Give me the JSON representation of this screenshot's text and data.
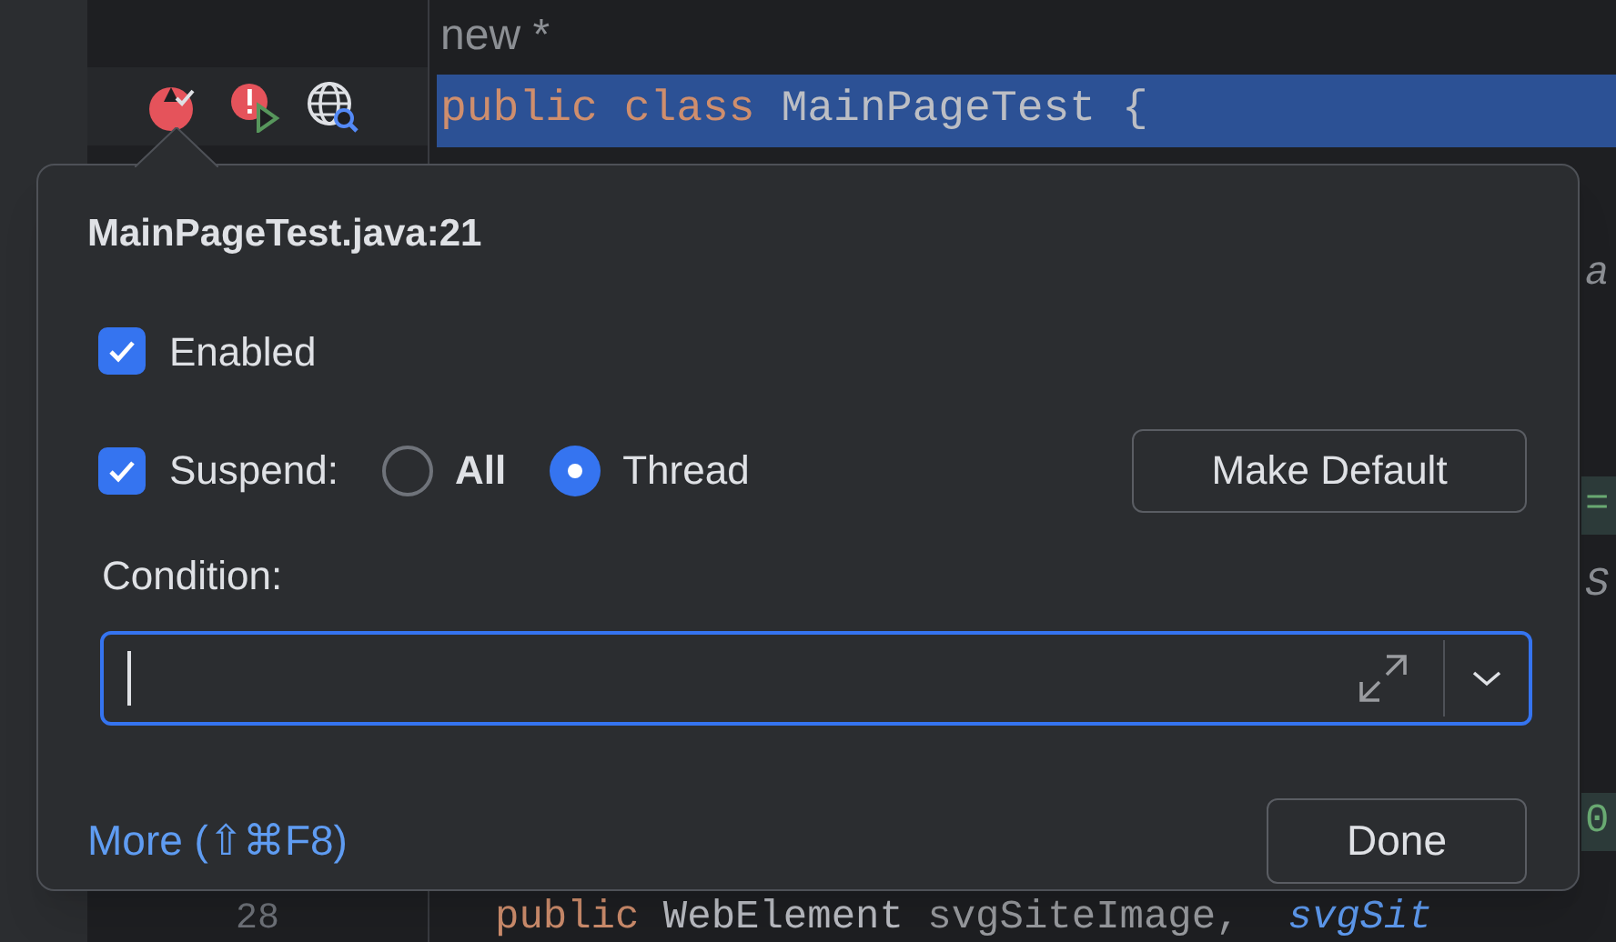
{
  "editor": {
    "lines": [
      {
        "text": [
          {
            "kind": "hint",
            "text": "new *"
          }
        ],
        "selected": false
      },
      {
        "text": [
          {
            "kind": "keyword",
            "text": "public class "
          },
          {
            "kind": "plain",
            "text": "MainPageTest {"
          }
        ],
        "selected": true
      }
    ],
    "edge_fragments": [
      {
        "text": "a",
        "kind": "italic"
      },
      {
        "text": "=",
        "kind": "highlight"
      },
      {
        "text": "S",
        "kind": "italic"
      },
      {
        "text": "0",
        "kind": "highlight"
      }
    ],
    "last_line": {
      "number": "28",
      "text": [
        {
          "kind": "keyword",
          "text": "public "
        },
        {
          "kind": "plain",
          "text": "WebElement "
        },
        {
          "kind": "dim",
          "text": "svgSiteImage,  "
        },
        {
          "kind": "field",
          "text": "svgSit"
        }
      ]
    }
  },
  "popup": {
    "title": "MainPageTest.java:21",
    "enabled": {
      "label": "Enabled",
      "checked": true
    },
    "suspend": {
      "label": "Suspend:",
      "checked": true
    },
    "options": [
      {
        "label": "All",
        "selected": false
      },
      {
        "label": "Thread",
        "selected": true
      }
    ],
    "make_default": "Make Default",
    "condition_label": "Condition:",
    "more_link": "More (⇧⌘F8)",
    "done": "Done"
  }
}
